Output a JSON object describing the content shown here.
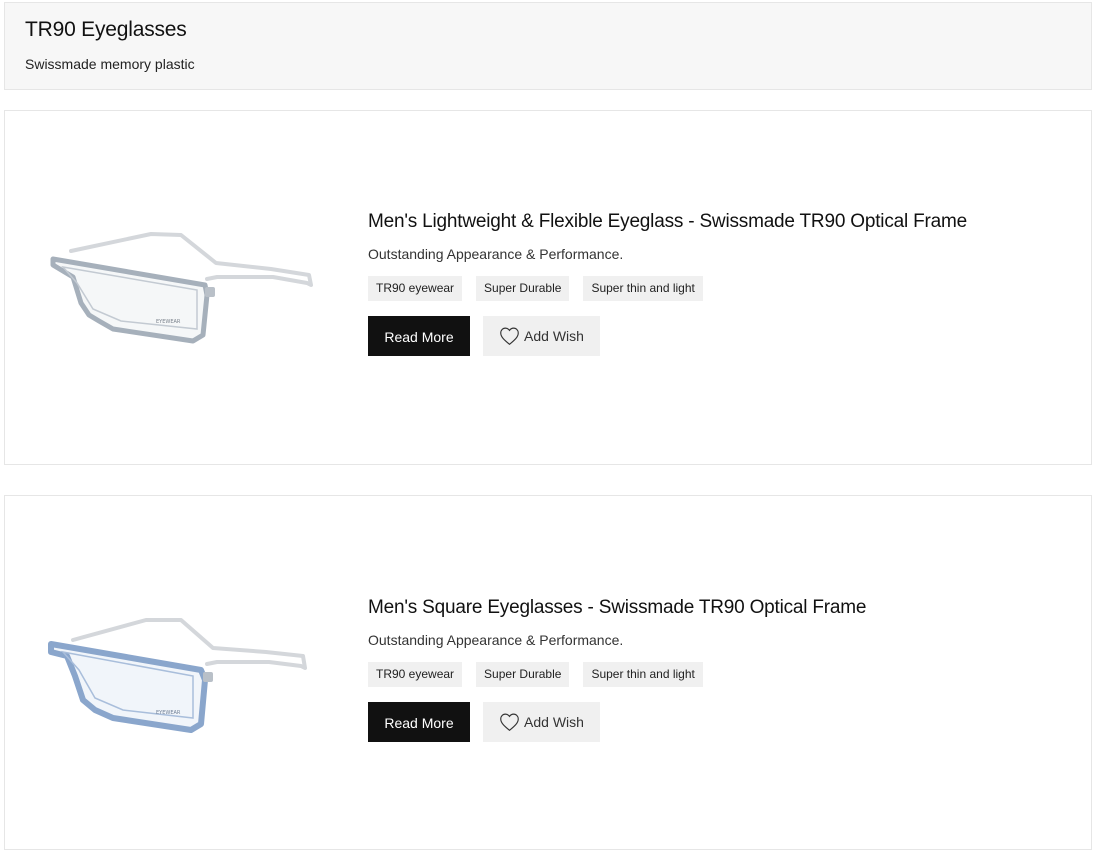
{
  "header": {
    "title": "TR90 Eyeglasses",
    "subtitle": "Swissmade memory plastic"
  },
  "products": [
    {
      "title": "Men's Lightweight & Flexible Eyeglass - Swissmade TR90 Optical Frame",
      "description": "Outstanding Appearance & Performance.",
      "tags": [
        "TR90 eyewear",
        "Super Durable",
        "Super thin and light"
      ],
      "read_more_label": "Read More",
      "wish_label": "Add Wish",
      "frame_color": "#9aa6b3",
      "image_icon": "eyeglasses-image"
    },
    {
      "title": "Men's Square Eyeglasses - Swissmade TR90 Optical Frame",
      "description": "Outstanding Appearance & Performance.",
      "tags": [
        "TR90 eyewear",
        "Super Durable",
        "Super thin and light"
      ],
      "read_more_label": "Read More",
      "wish_label": "Add Wish",
      "frame_color": "#7f9ec8",
      "image_icon": "eyeglasses-image"
    }
  ],
  "icons": {
    "wish": "heart-icon"
  },
  "colors": {
    "primary_button": "#111111",
    "secondary_button": "#f0f0f0",
    "tag_background": "#f0f0f0",
    "header_background": "#f7f7f7"
  }
}
